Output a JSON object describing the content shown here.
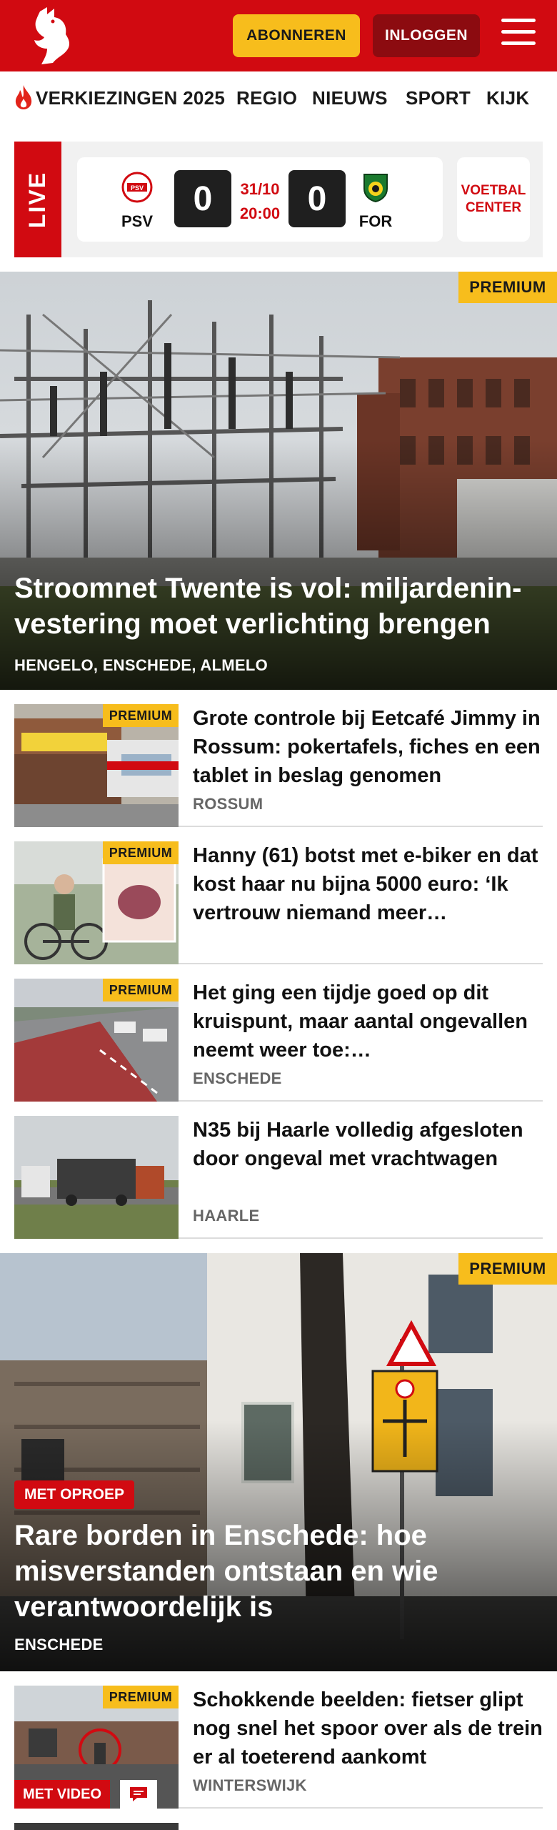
{
  "header": {
    "subscribe_label": "ABONNEREN",
    "login_label": "INLOGGEN",
    "brand_color": "#d10a11",
    "accent_color": "#f7bd1c"
  },
  "nav": {
    "items": [
      {
        "label": "VERKIEZINGEN 2025",
        "icon": "flame-icon"
      },
      {
        "label": "REGIO"
      },
      {
        "label": "NIEUWS"
      },
      {
        "label": "SPORT"
      },
      {
        "label": "KIJK"
      }
    ]
  },
  "live": {
    "label": "LIVE",
    "home_team": "PSV",
    "away_team": "FOR",
    "home_score": "0",
    "away_score": "0",
    "date": "31/10",
    "time": "20:00",
    "center_label": "VOETBAL CENTER"
  },
  "premium_label": "PREMIUM",
  "hero1": {
    "title": "Stroomnet Twente is vol: miljardenin-vestering moet verlichting brengen",
    "location": "HENGELO, ENSCHEDE, ALMELO",
    "premium": true
  },
  "articles": [
    {
      "title": "Grote controle bij Eetcafé Jimmy in Rossum: pokertafels, fiches en een tablet in beslag genomen",
      "location": "ROSSUM",
      "premium": true
    },
    {
      "title": "Hanny (61) botst met e-biker en dat kost haar nu bijna 5000 euro: ‘Ik vertrouw niemand meer…",
      "location": "",
      "premium": true
    },
    {
      "title": "Het ging een tijdje goed op dit kruispunt, maar aantal ongevallen neemt weer toe:…",
      "location": "ENSCHEDE",
      "premium": true
    },
    {
      "title": "N35 bij Haarle volledig afgesloten door ongeval met vrachtwagen",
      "location": "HAARLE",
      "premium": false
    }
  ],
  "hero2": {
    "tag": "MET OPROEP",
    "title": "Rare borden in Enschede: hoe misverstanden ontstaan en wie verantwoordelijk is",
    "location": "ENSCHEDE",
    "premium": true
  },
  "article_video": {
    "title": "Schokkende beelden: fietser glipt nog snel het spoor over als de trein er al toeterend aankomt",
    "location": "WINTERSWIJK",
    "video_label": "MET VIDEO",
    "premium": true
  }
}
